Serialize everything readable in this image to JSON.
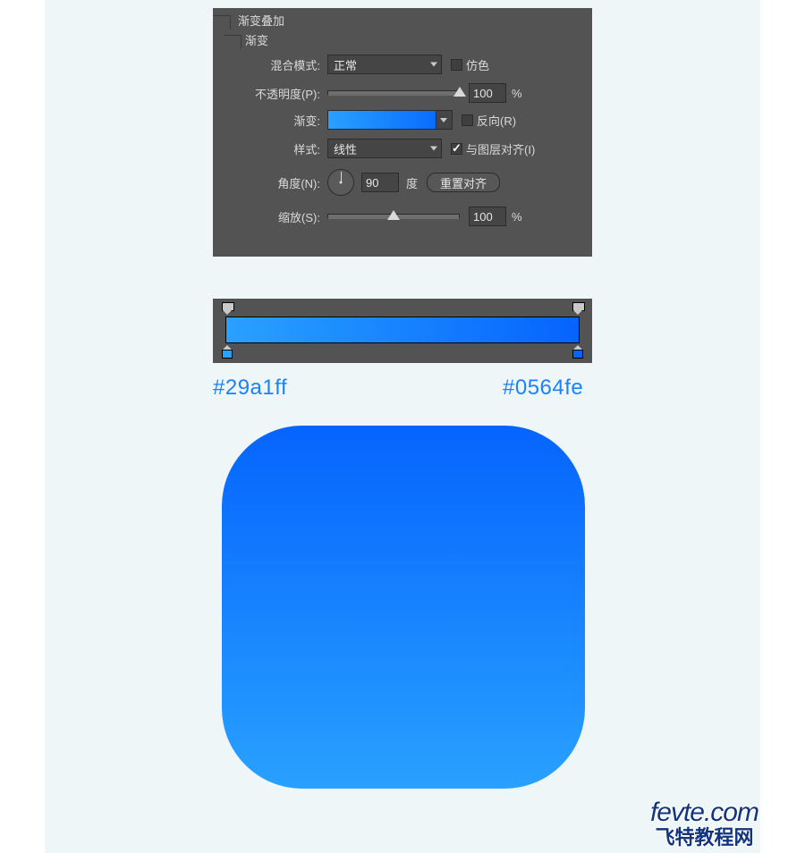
{
  "panel": {
    "group_title": "渐变叠加",
    "section_title": "渐变",
    "blend_mode": {
      "label": "混合模式:",
      "value": "正常",
      "dither_label": "仿色",
      "dither_checked": false
    },
    "opacity": {
      "label": "不透明度(P):",
      "value": "100",
      "unit": "%",
      "slider_pct": 100
    },
    "gradient": {
      "label": "渐变:",
      "reverse_label": "反向(R)",
      "reverse_checked": false
    },
    "style": {
      "label": "样式:",
      "value": "线性",
      "align_label": "与图层对齐(I)",
      "align_checked": true
    },
    "angle": {
      "label": "角度(N):",
      "value": "90",
      "unit": "度",
      "reset_label": "重置对齐"
    },
    "scale": {
      "label": "缩放(S):",
      "value": "100",
      "unit": "%",
      "slider_pct": 50
    }
  },
  "editor": {
    "stop_left_color": "#29a1ff",
    "stop_right_color": "#0564fe"
  },
  "hex_left": "#29a1ff",
  "hex_right": "#0564fe",
  "watermark": {
    "line1": "fevte.com",
    "line2": "飞特教程网"
  }
}
